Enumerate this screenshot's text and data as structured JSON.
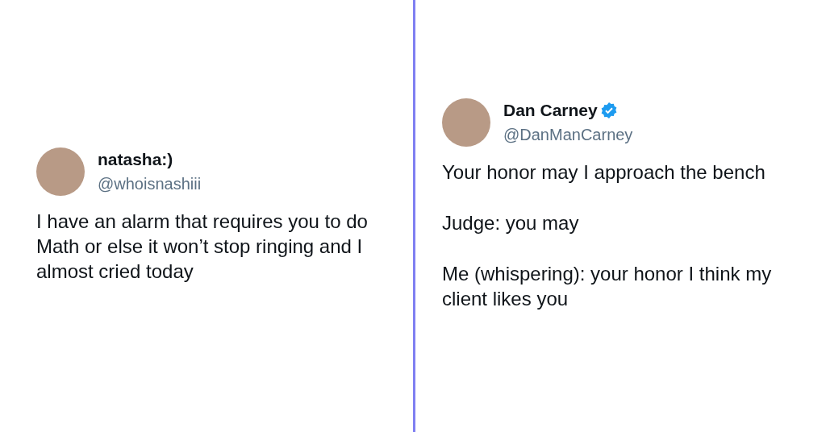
{
  "tweets": [
    {
      "name": "natasha:)",
      "handle": "@whoisnashiii",
      "verified": false,
      "paragraphs": [
        "I have an alarm that requires you to do Math or else it won’t stop ringing and I almost cried today"
      ]
    },
    {
      "name": "Dan Carney",
      "handle": "@DanManCarney",
      "verified": true,
      "paragraphs": [
        "Your honor may I approach the bench",
        "Judge: you may",
        "Me (whispering): your honor I think my client likes you"
      ]
    }
  ]
}
